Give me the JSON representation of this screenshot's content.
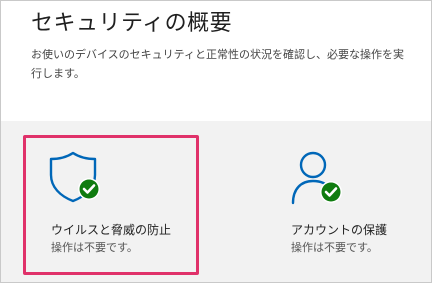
{
  "header": {
    "title": "セキュリティの概要",
    "description": "お使いのデバイスのセキュリティと正常性の状況を確認し、必要な操作を実行します。"
  },
  "cards": [
    {
      "icon": "shield-check-icon",
      "title": "ウイルスと脅威の防止",
      "status": "操作は不要です。"
    },
    {
      "icon": "person-check-icon",
      "title": "アカウントの保護",
      "status": "操作は不要です。"
    }
  ],
  "colors": {
    "accent": "#0067b8",
    "ok": "#107c10",
    "focus": "#e0326a"
  }
}
